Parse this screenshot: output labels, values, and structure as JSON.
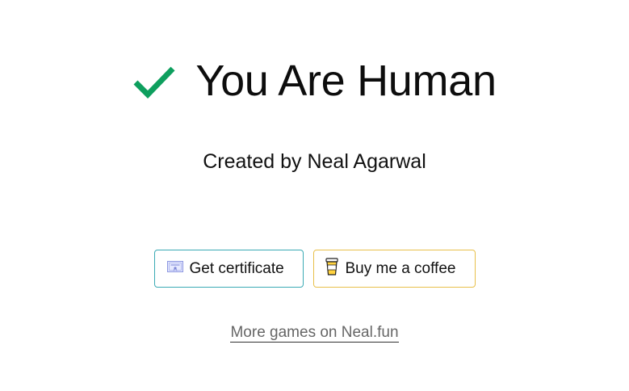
{
  "header": {
    "check_icon": "checkmark-icon",
    "title": "You Are Human"
  },
  "credit": {
    "text": "Created by Neal Agarwal"
  },
  "buttons": {
    "certificate": {
      "label": "Get certificate",
      "icon": "certificate-icon"
    },
    "coffee": {
      "label": "Buy me a coffee",
      "icon": "coffee-cup-icon"
    }
  },
  "links": {
    "more_games": "More games on Neal.fun"
  },
  "colors": {
    "check": "#0e9f5e",
    "certificate_border": "#3aaab4",
    "coffee_border": "#e8c04a",
    "link": "#666666"
  }
}
